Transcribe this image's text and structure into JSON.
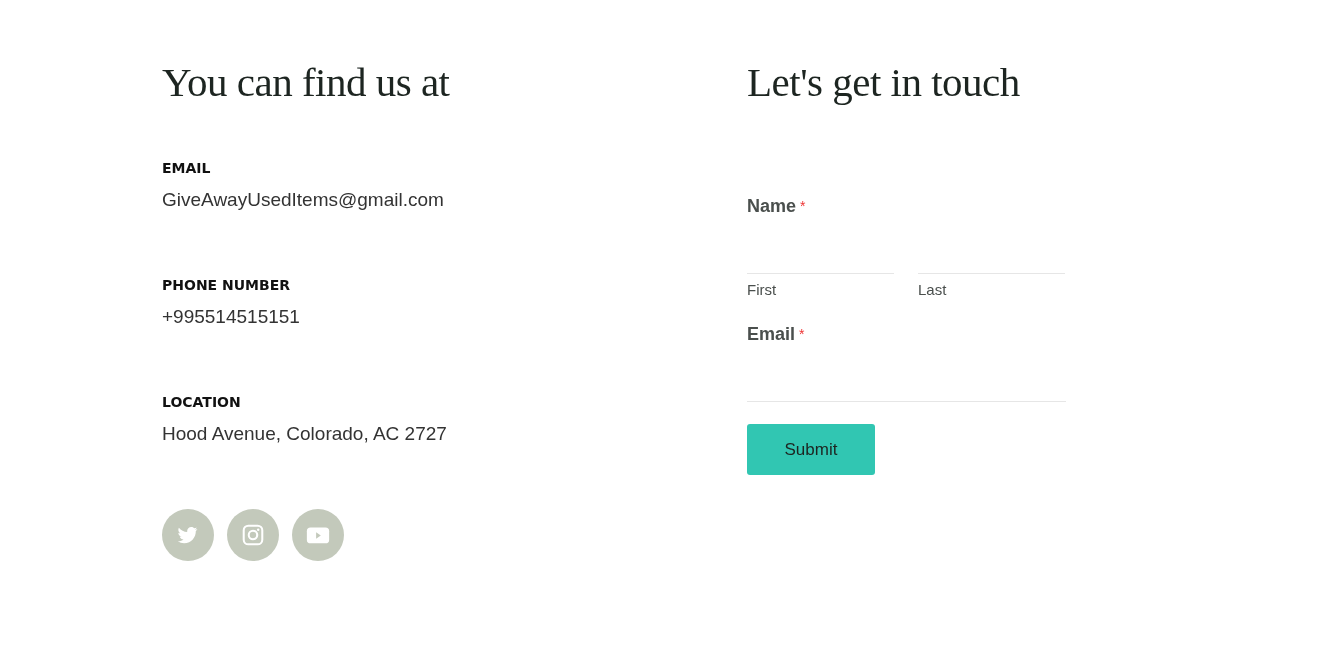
{
  "contact_info": {
    "title": "You can find us at",
    "items": [
      {
        "label": "EMAIL",
        "value": "GiveAwayUsedItems@gmail.com"
      },
      {
        "label": "PHONE NUMBER",
        "value": "+995514515151"
      },
      {
        "label": "LOCATION",
        "value": "Hood Avenue, Colorado, AC 2727"
      }
    ],
    "social": [
      {
        "kind": "bird"
      },
      {
        "kind": "camera"
      },
      {
        "kind": "play"
      }
    ]
  },
  "contact_form": {
    "title": "Let's get in touch",
    "fields": [
      {
        "kind": "name",
        "label": "Name",
        "required": true,
        "required_mark": "*",
        "parts": [
          {
            "sublabel": "First"
          },
          {
            "sublabel": "Last"
          }
        ]
      },
      {
        "kind": "email",
        "label": "Email",
        "required": true,
        "required_mark": "*"
      }
    ],
    "submit": "Submit"
  }
}
